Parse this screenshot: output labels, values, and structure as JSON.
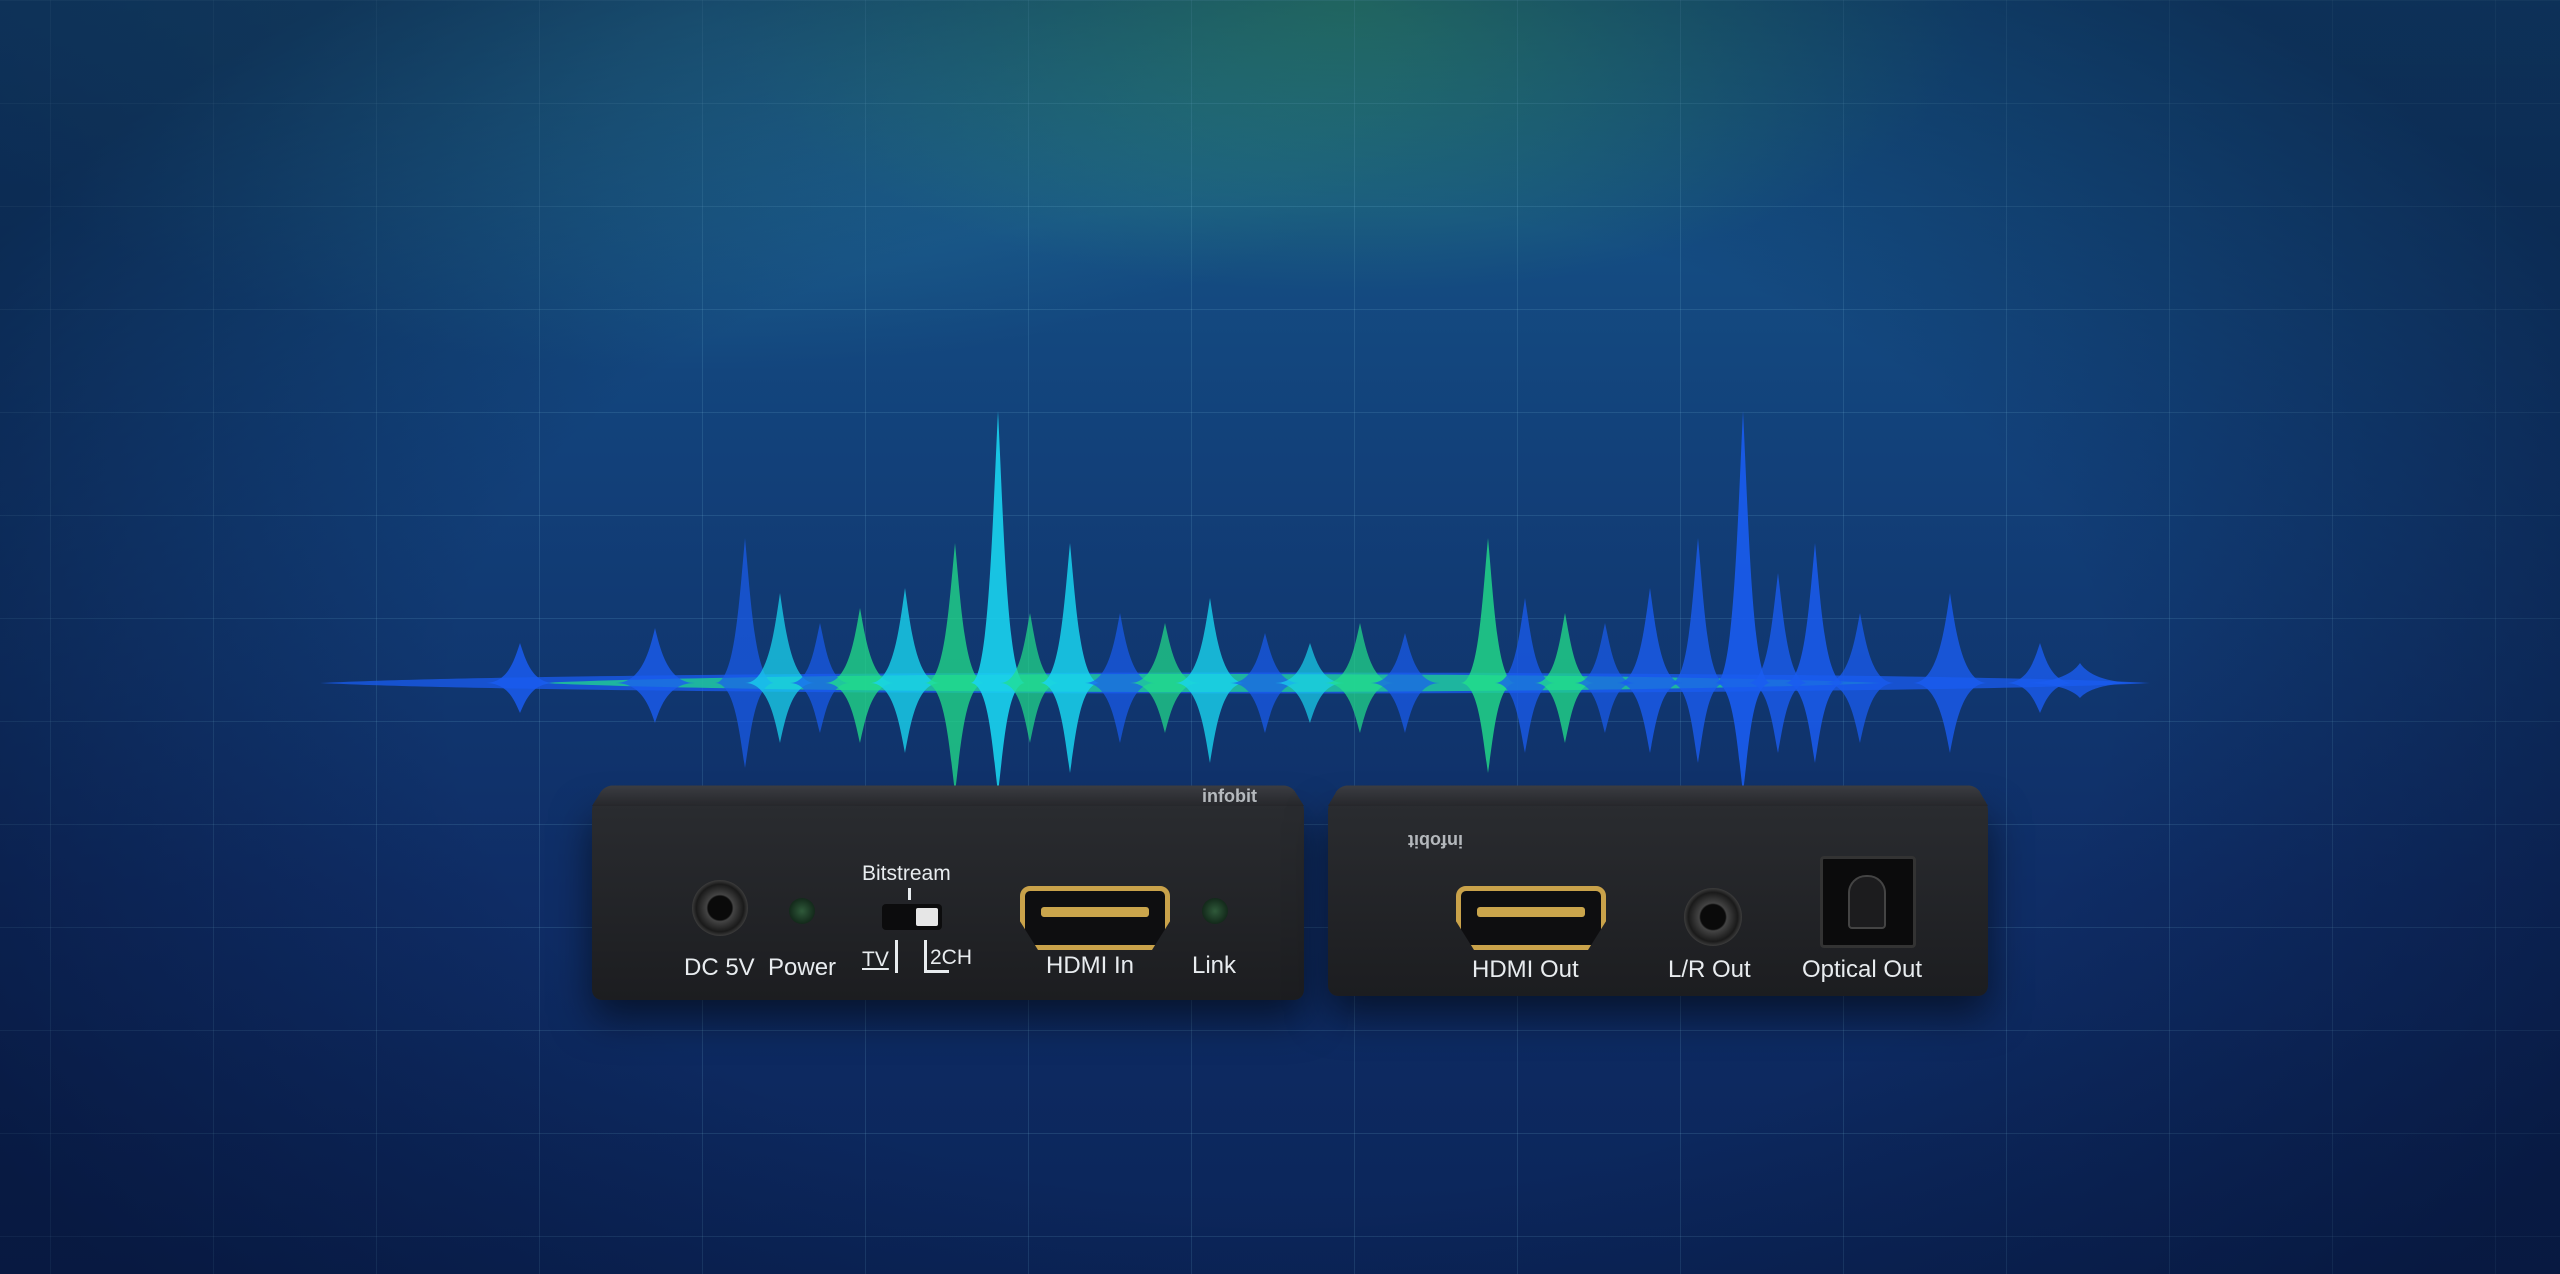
{
  "receiver": {
    "brand": "infobit",
    "labels": {
      "dc": "DC 5V",
      "power": "Power",
      "bitstream": "Bitstream",
      "tv": "TV",
      "ch2": "2CH",
      "hdmi_in": "HDMI In",
      "link": "Link"
    }
  },
  "extractor": {
    "brand": "infobit",
    "labels": {
      "hdmi_out": "HDMI Out",
      "lr_out": "L/R Out",
      "optical_out": "Optical Out"
    }
  },
  "colors": {
    "wave_cyan": "#19d3ee",
    "wave_green": "#22e08a",
    "wave_blue": "#1a5cf0",
    "background": "#0f2d66"
  }
}
